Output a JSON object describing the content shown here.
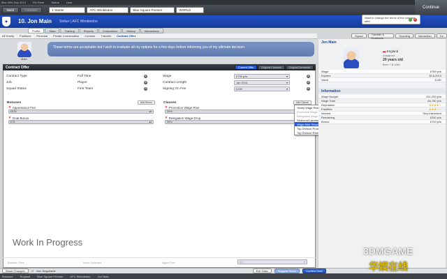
{
  "topbar": {
    "items": [
      "Mon 30th Sep 2013",
      "FM Store",
      "Status",
      "Data",
      "Help",
      "Start",
      "FM",
      "Settings"
    ]
  },
  "nav": {
    "back": "Back",
    "forward": "Forward",
    "crumb1": "1 Starter",
    "crumb2": "AFC Wimbledon",
    "crumb3": "Blue Square Premier",
    "crumb4": "WORLD",
    "fm": "FM"
  },
  "continue_label": "Continue",
  "header": {
    "title": "10. Jon Main",
    "subtitle": "Striker | AFC Wimbledon"
  },
  "notice": {
    "text": "Want to change the terms of the contract offer"
  },
  "tabs": [
    "Profile",
    "Stats",
    "Training",
    "Reports",
    "Comparison",
    "History",
    "Interactions"
  ],
  "subnav": [
    "All Hourly",
    "Positions",
    "Personal",
    "Private Conversation",
    "Contract",
    "Transfer",
    "Contract Offer"
  ],
  "right_buttons": [
    "Squad",
    "Transfer & Contracts",
    "Scouting",
    "Interaction",
    "Go"
  ],
  "intro": {
    "player_name": "Main",
    "message": "These terms are acceptable but I wish to evaluate all my options for a few days before informing you of my ultimate decision."
  },
  "contract": {
    "title": "Contract Offer",
    "tabs": [
      "Current Offer",
      "Original Contract",
      "Original Demands"
    ],
    "left_rows": [
      {
        "label": "Contract Type",
        "value": "Full Time"
      },
      {
        "label": "Job",
        "value": "Player"
      },
      {
        "label": "Squad Status",
        "value": "First Team"
      }
    ],
    "right_rows": [
      {
        "label": "Wage",
        "value": "£750 p/w"
      },
      {
        "label": "Contract Length",
        "value": "Jan 2014"
      },
      {
        "label": "Signing On Fee",
        "value": "£100"
      }
    ],
    "bonuses": {
      "title": "Bonuses",
      "add_label": "Add Bonus",
      "items": [
        {
          "label": "Appearance Fee",
          "value": "£575"
        },
        {
          "label": "Goal Bonus",
          "value": "£75"
        }
      ]
    },
    "clauses": {
      "title": "Clauses",
      "add_label": "Add Clause",
      "items": [
        {
          "label": "Promotion Wage Rise",
          "value": "20%"
        },
        {
          "label": "Relegation Wage Drop",
          "value": "20%"
        }
      ],
      "menu": [
        {
          "label": "Yearly Wage Rise",
          "state": "normal"
        },
        {
          "label": "Promotion Wage Rise",
          "state": "disabled"
        },
        {
          "label": "Relegation Wage Drop",
          "state": "disabled"
        },
        {
          "label": "Seasonal Landmark Goal Bonus",
          "state": "normal"
        },
        {
          "label": "Wage After Reaching Club Career League Games",
          "state": "highlighted"
        },
        {
          "label": "Top Division Promotion Wage Rise",
          "state": "normal"
        },
        {
          "label": "Top Division Relegation Wage Drop",
          "state": "normal"
        }
      ]
    },
    "watermark": "Work In Progress",
    "bottom_left_label": "Transfer Fees",
    "bottom_left_value": "None Selected",
    "bottom_right_label": "Agent Fee",
    "bottom_right_value": "£0"
  },
  "footer": {
    "reset": "Reset Changes",
    "nonneg": "Non Negotiable",
    "exit": "Exit Talks",
    "suggest": "Suggest Terms",
    "confirm": "Confirm Deal",
    "breadcrumb": [
      "Bonuses",
      "England",
      "Blue Square Premier",
      "AFC Wimbledon",
      "Jon Main"
    ]
  },
  "right": {
    "name": "Jon Main",
    "nation": "England",
    "status": "Unsigned",
    "age": "29 years old",
    "born": "Born 7.8.1981",
    "rows": [
      {
        "label": "Wage",
        "value": "£750 p/w"
      },
      {
        "label": "Expires",
        "value": "30.6.2013"
      },
      {
        "label": "Value",
        "value": "£14K"
      }
    ],
    "info_title": "Information",
    "info_rows": [
      {
        "label": "Wage Budget",
        "value": "£11,250 p/w",
        "stars": ""
      },
      {
        "label": "Wage Total",
        "value": "£6,750 p/w",
        "stars": ""
      },
      {
        "label": "Reputation",
        "value": "",
        "stars": "★★★★☆"
      },
      {
        "label": "Facilities",
        "value": "",
        "stars": "★★★☆☆"
      },
      {
        "label": "Interest",
        "value": "Very interested",
        "stars": ""
      },
      {
        "label": "Remaining",
        "value": "£250 p/w",
        "stars": ""
      },
      {
        "label": "Bonus",
        "value": "£720 p/w",
        "stars": ""
      }
    ]
  },
  "site_watermark": {
    "line1": "3DMGAME",
    "line2": "华娱在线"
  },
  "colors": {
    "header_blue": "#1d47b0",
    "highlight": "#2a5bd0",
    "panel_dark": "#2e3338"
  }
}
